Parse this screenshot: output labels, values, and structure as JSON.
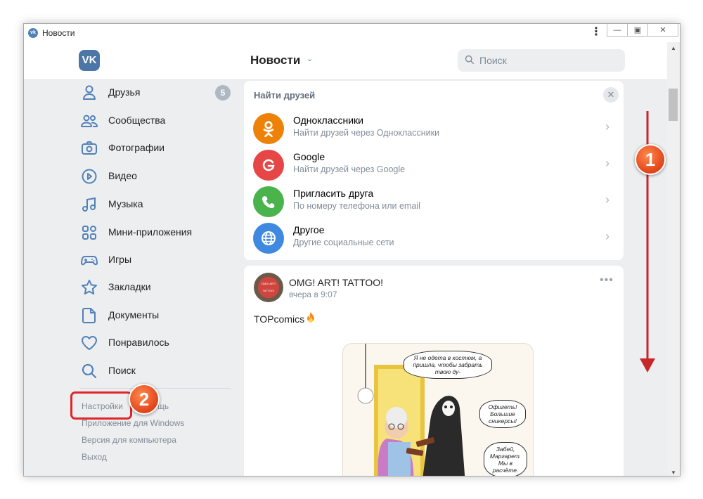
{
  "window": {
    "title": "Новости"
  },
  "header": {
    "logo_text": "VK",
    "title": "Новости",
    "search_placeholder": "Поиск"
  },
  "sidebar": {
    "items": [
      {
        "label": "Друзья",
        "icon": "user-icon",
        "badge": "5"
      },
      {
        "label": "Сообщества",
        "icon": "communities-icon"
      },
      {
        "label": "Фотографии",
        "icon": "camera-icon"
      },
      {
        "label": "Видео",
        "icon": "video-play-icon"
      },
      {
        "label": "Музыка",
        "icon": "music-note-icon"
      },
      {
        "label": "Мини-приложения",
        "icon": "apps-grid-icon"
      },
      {
        "label": "Игры",
        "icon": "gamepad-icon"
      },
      {
        "label": "Закладки",
        "icon": "star-icon"
      },
      {
        "label": "Документы",
        "icon": "document-icon"
      },
      {
        "label": "Понравилось",
        "icon": "heart-icon"
      },
      {
        "label": "Поиск",
        "icon": "search-icon"
      }
    ],
    "links": {
      "settings": "Настройки",
      "help_tail": "щь",
      "windows_app": "Приложение для Windows",
      "desktop": "Версия для компьютера",
      "logout": "Выход"
    }
  },
  "friends_card": {
    "title": "Найти друзей",
    "rows": [
      {
        "name": "Одноклассники",
        "sub": "Найти друзей через Одноклассники",
        "color": "#ee8208",
        "icon": "odnoklassniki-icon"
      },
      {
        "name": "Google",
        "sub": "Найти друзей через Google",
        "color": "#e64646",
        "icon": "google-icon"
      },
      {
        "name": "Пригласить друга",
        "sub": "По номеру телефона или email",
        "color": "#4bb34b",
        "icon": "phone-icon"
      },
      {
        "name": "Другое",
        "sub": "Другие социальные сети",
        "color": "#3f8ae0",
        "icon": "globe-icon"
      }
    ]
  },
  "post": {
    "author": "OMG! ART! TATTOO!",
    "avatar_text": "OMG! ART! TATTOO!",
    "time": "вчера в 9:07",
    "text": "TOPcomics",
    "comic_bubbles": [
      "Я не одета в костюм, а пришла, чтобы забрать твою ду-",
      "Офигеть! Большие сникерсы!",
      "Забей, Маргарет. Мы в расчёте."
    ]
  },
  "annotations": {
    "badge_1": "1",
    "badge_2": "2"
  },
  "colors": {
    "vk_blue": "#4a76a8",
    "accent": "#5181b8",
    "annotation_red": "#e0262b",
    "annotation_orange": "#e2431a"
  }
}
